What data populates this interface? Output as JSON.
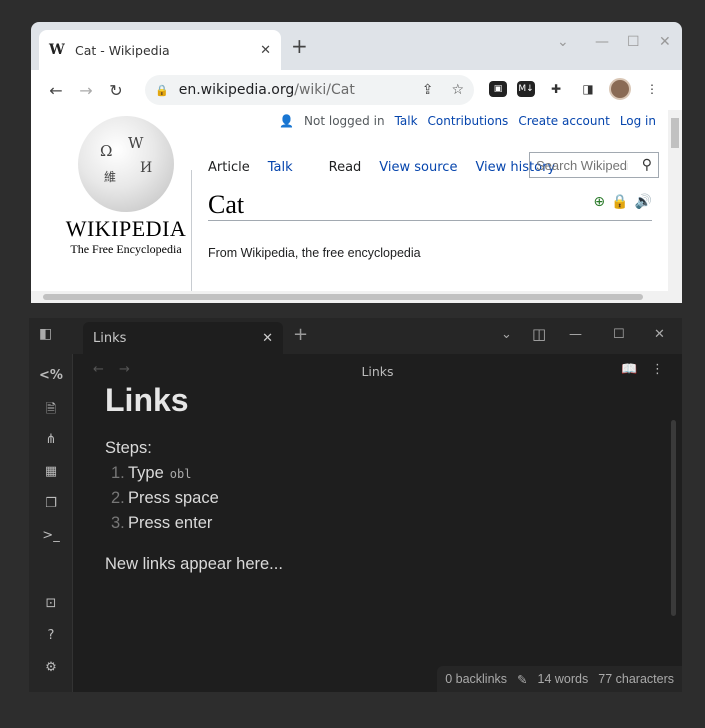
{
  "browser": {
    "tab": {
      "favicon": "W",
      "title": "Cat - Wikipedia",
      "close": "✕"
    },
    "new_tab": "+",
    "window_controls": {
      "dropdown": "⌄",
      "minimize": "—",
      "maximize": "☐",
      "close": "✕"
    },
    "toolbar": {
      "back": "←",
      "forward": "→",
      "reload": "↻"
    },
    "address": {
      "host": "en.wikipedia.org",
      "path": "/wiki/Cat",
      "share": "⇪",
      "bookmark": "☆"
    },
    "extensions": {
      "ext1": "▣",
      "markdown": "M↓",
      "puzzle": "✚",
      "sidepanel": "◨",
      "menu": "⋮"
    }
  },
  "wikipedia": {
    "logo": {
      "wordmark": "WIKIPEDIA",
      "tagline": "The Free Encyclopedia",
      "glyphs": [
        "Ω",
        "W",
        "維",
        "И"
      ]
    },
    "personal": {
      "status": "Not logged in",
      "talk": "Talk",
      "contributions": "Contributions",
      "create_account": "Create account",
      "log_in": "Log in",
      "user_icon": "👤"
    },
    "tabs": {
      "article": "Article",
      "talk": "Talk",
      "read": "Read",
      "view_source": "View source",
      "view_history": "View history"
    },
    "search": {
      "placeholder": "Search Wikipedi",
      "icon": "⚲"
    },
    "heading": "Cat",
    "indicators": {
      "plus": "⊕",
      "lock": "🔒",
      "audio": "🔊"
    },
    "from": "From Wikipedia, the free encyclopedia"
  },
  "obsidian": {
    "tab": {
      "title": "Links",
      "close": "✕"
    },
    "new_tab": "+",
    "window_controls": {
      "dropdown": "⌄",
      "layout": "◫",
      "minimize": "—",
      "maximize": "☐",
      "close": "✕"
    },
    "ribbon": {
      "sidebar": "◧",
      "code": "<%",
      "file": "🗎",
      "graph": "⋔",
      "calendar": "▦",
      "copy": "❐",
      "terminal": ">_",
      "vault": "⊡",
      "help": "?",
      "settings": "⚙"
    },
    "nav": {
      "back": "←",
      "forward": "→",
      "title": "Links",
      "reading": "📖",
      "more": "⋮"
    },
    "note": {
      "title": "Links",
      "steps_label": "Steps:",
      "steps": [
        {
          "num": "1.",
          "text": "Type",
          "code": "obl"
        },
        {
          "num": "2.",
          "text": "Press space"
        },
        {
          "num": "3.",
          "text": "Press enter"
        }
      ],
      "new_links": "New links appear here..."
    },
    "status": {
      "backlinks": "0 backlinks",
      "edit_icon": "✎",
      "words": "14 words",
      "characters": "77 characters"
    }
  }
}
